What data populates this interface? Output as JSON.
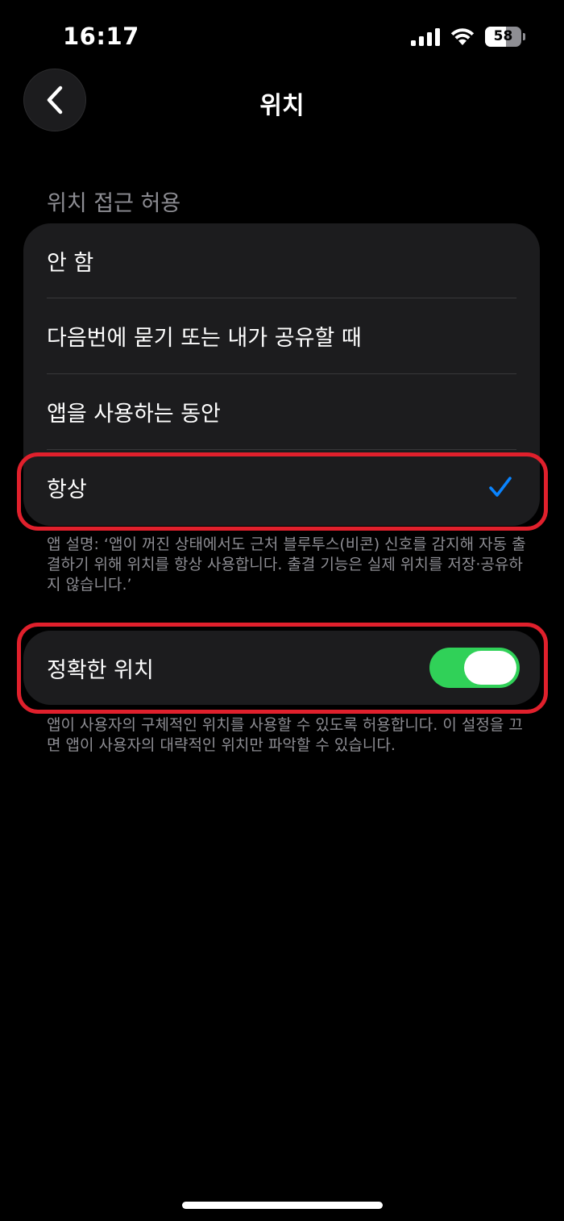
{
  "status_bar": {
    "time": "16:17",
    "battery_level": "58",
    "battery_fraction": 0.58
  },
  "nav": {
    "title": "위치",
    "back_icon": "chevron-left-icon"
  },
  "location_access": {
    "header": "위치 접근 허용",
    "options": [
      {
        "label": "안 함",
        "selected": false
      },
      {
        "label": "다음번에 묻기 또는 내가 공유할 때",
        "selected": false
      },
      {
        "label": "앱을 사용하는 동안",
        "selected": false
      },
      {
        "label": "항상",
        "selected": true
      }
    ],
    "footer": "앱 설명: ‘앱이 꺼진 상태에서도 근처 블루투스(비콘) 신호를 감지해 자동 출결하기 위해 위치를 항상 사용합니다. 출결 기능은 실제 위치를 저장·공유하지 않습니다.’"
  },
  "precise_location": {
    "label": "정확한 위치",
    "enabled": true,
    "footer": "앱이 사용자의 구체적인 위치를 사용할 수 있도록 허용합니다. 이 설정을 끄면 앱이 사용자의 대략적인 위치만 파악할 수 있습니다."
  },
  "colors": {
    "accent": "#0a84ff",
    "toggle_on": "#30d158",
    "highlight": "#e0202c",
    "background": "#000000",
    "cell": "#1c1c1e",
    "secondary_text": "#8d8d93"
  }
}
